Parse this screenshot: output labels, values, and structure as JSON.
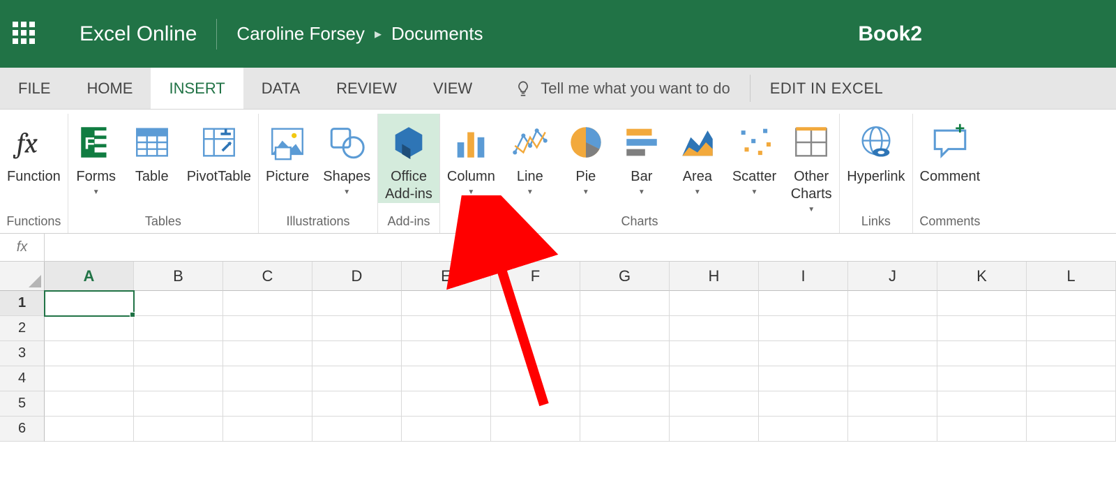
{
  "header": {
    "app_name": "Excel Online",
    "user_name": "Caroline Forsey",
    "folder": "Documents",
    "doc_title": "Book2"
  },
  "tabs": {
    "items": [
      "FILE",
      "HOME",
      "INSERT",
      "DATA",
      "REVIEW",
      "VIEW"
    ],
    "active_index": 2,
    "tellme_placeholder": "Tell me what you want to do",
    "edit_label": "EDIT IN EXCEL"
  },
  "ribbon": {
    "groups": [
      {
        "label": "Functions",
        "items": [
          {
            "label": "Function",
            "icon": "function",
            "dd": false
          }
        ]
      },
      {
        "label": "Tables",
        "items": [
          {
            "label": "Forms",
            "icon": "forms",
            "dd": true
          },
          {
            "label": "Table",
            "icon": "table",
            "dd": false
          },
          {
            "label": "PivotTable",
            "icon": "pivottable",
            "dd": false
          }
        ]
      },
      {
        "label": "Illustrations",
        "items": [
          {
            "label": "Picture",
            "icon": "picture",
            "dd": false
          },
          {
            "label": "Shapes",
            "icon": "shapes",
            "dd": true
          }
        ]
      },
      {
        "label": "Add-ins",
        "items": [
          {
            "label": "Office Add-ins",
            "icon": "addins",
            "dd": false,
            "highlighted": true
          }
        ]
      },
      {
        "label": "Charts",
        "items": [
          {
            "label": "Column",
            "icon": "chart-column",
            "dd": true
          },
          {
            "label": "Line",
            "icon": "chart-line",
            "dd": true
          },
          {
            "label": "Pie",
            "icon": "chart-pie",
            "dd": true
          },
          {
            "label": "Bar",
            "icon": "chart-bar",
            "dd": true
          },
          {
            "label": "Area",
            "icon": "chart-area",
            "dd": true
          },
          {
            "label": "Scatter",
            "icon": "chart-scatter",
            "dd": true
          },
          {
            "label": "Other Charts",
            "icon": "chart-other",
            "dd": true
          }
        ]
      },
      {
        "label": "Links",
        "items": [
          {
            "label": "Hyperlink",
            "icon": "hyperlink",
            "dd": false
          }
        ]
      },
      {
        "label": "Comments",
        "items": [
          {
            "label": "Comment",
            "icon": "comment",
            "dd": false
          }
        ]
      }
    ]
  },
  "formula_bar": {
    "fx": "fx",
    "value": ""
  },
  "grid": {
    "columns": [
      "A",
      "B",
      "C",
      "D",
      "E",
      "F",
      "G",
      "H",
      "I",
      "J",
      "K",
      "L"
    ],
    "rows": [
      "1",
      "2",
      "3",
      "4",
      "5",
      "6"
    ],
    "selected_col": "A",
    "selected_row": "1"
  }
}
